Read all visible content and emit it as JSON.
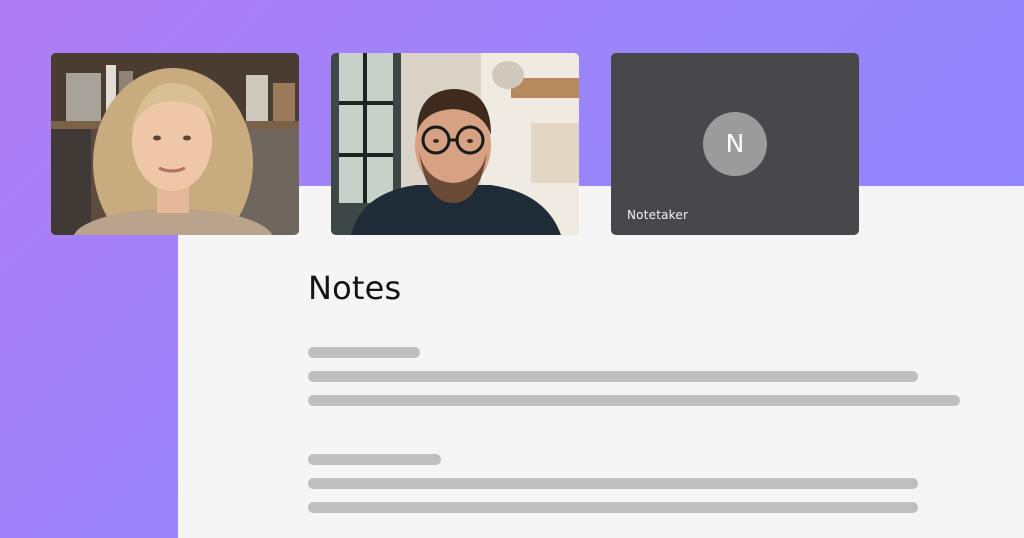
{
  "participants": [
    {
      "kind": "video",
      "description_icon": "participant-woman-video"
    },
    {
      "kind": "video",
      "description_icon": "participant-man-video"
    },
    {
      "kind": "avatar",
      "initial": "N",
      "name": "Notetaker"
    }
  ],
  "notes": {
    "title": "Notes"
  },
  "colors": {
    "gradient_start": "#b07cf5",
    "gradient_end": "#8d83fb",
    "panel": "#f5f5f5",
    "tile_dark": "#48484b",
    "avatar": "#9b9b9b",
    "placeholder": "#bfbfbf"
  }
}
